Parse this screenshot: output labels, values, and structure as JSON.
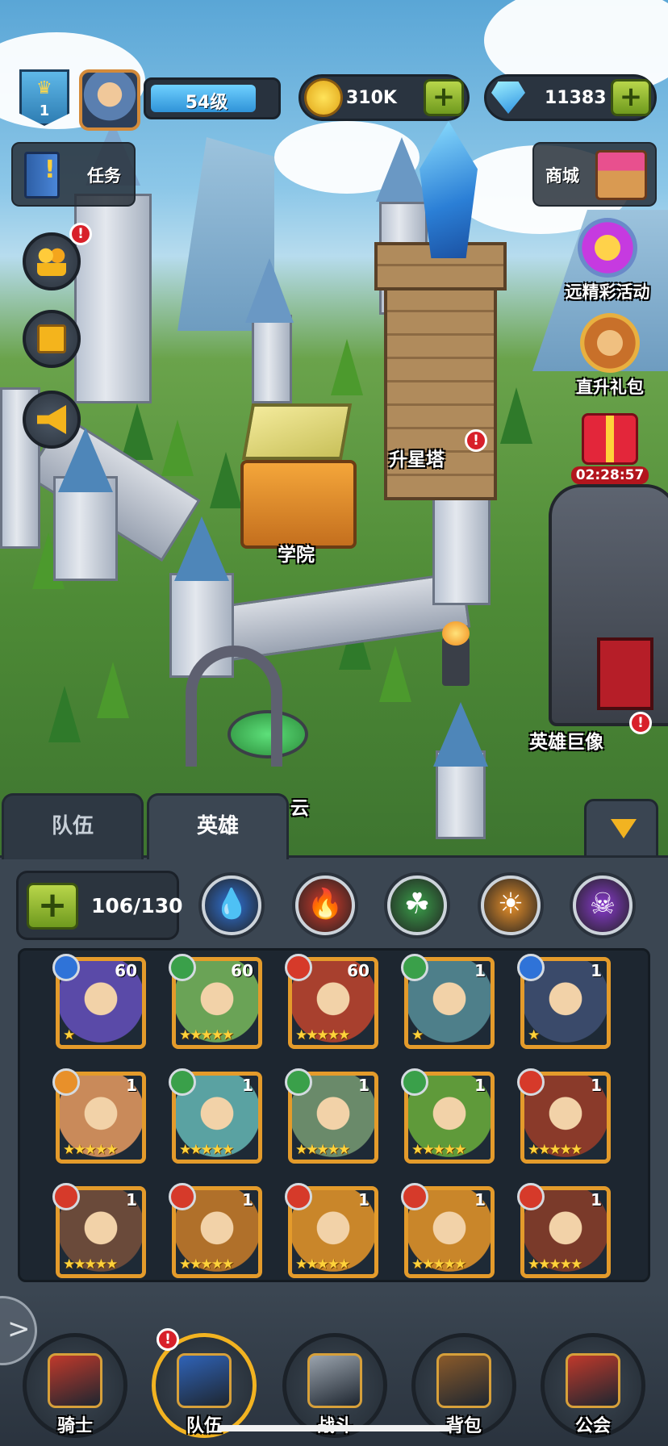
{
  "hud": {
    "rank": "1",
    "level_label": "54级",
    "gold": "310K",
    "gems": "11383"
  },
  "left_menu": {
    "quest_label": "任务"
  },
  "right_menu": {
    "shop_label": "商城",
    "events": [
      {
        "label": "远精彩活动"
      },
      {
        "label": "直升礼包"
      },
      {
        "timer": "02:28:57"
      }
    ]
  },
  "map_labels": {
    "star_tower": "升星塔",
    "academy": "学院",
    "hero_statue": "英雄巨像",
    "partial": "云"
  },
  "alert_glyph": "!",
  "panel": {
    "tabs": [
      {
        "label": "队伍",
        "active": false
      },
      {
        "label": "英雄",
        "active": true
      }
    ],
    "hero_count": "106/130",
    "element_filters": [
      {
        "name": "water",
        "icon": "water-drop-icon",
        "color": "#2f73d8",
        "glyph": "💧"
      },
      {
        "name": "fire",
        "icon": "flame-icon",
        "color": "#d63a2a",
        "glyph": "🔥"
      },
      {
        "name": "nature",
        "icon": "clover-icon",
        "color": "#3aa04a",
        "glyph": "☘"
      },
      {
        "name": "light",
        "icon": "sun-icon",
        "color": "#e8902a",
        "glyph": "☀"
      },
      {
        "name": "dark",
        "icon": "skull-icon",
        "color": "#8a3ad0",
        "glyph": "☠"
      }
    ],
    "heroes": [
      {
        "element": "water",
        "level": "60",
        "stars": "★",
        "color": "#5a4aa8"
      },
      {
        "element": "nature",
        "level": "60",
        "stars": "★★★★★",
        "color": "#6aa356"
      },
      {
        "element": "fire",
        "level": "60",
        "stars": "★★★★★",
        "color": "#a8402e"
      },
      {
        "element": "nature",
        "level": "1",
        "stars": "★",
        "color": "#4e7f8a"
      },
      {
        "element": "water",
        "level": "1",
        "stars": "★",
        "color": "#3a4a6a"
      },
      {
        "element": "light",
        "level": "1",
        "stars": "★★★★★",
        "color": "#c98a5a"
      },
      {
        "element": "nature",
        "level": "1",
        "stars": "★★★★★",
        "color": "#5aa2a2"
      },
      {
        "element": "nature",
        "level": "1",
        "stars": "★★★★★",
        "color": "#6a8a6a"
      },
      {
        "element": "nature",
        "level": "1",
        "stars": "★★★★★",
        "color": "#5f9a3a"
      },
      {
        "element": "fire",
        "level": "1",
        "stars": "★★★★★",
        "color": "#8a3a2a"
      },
      {
        "element": "fire",
        "level": "1",
        "stars": "★★★★★",
        "color": "#6a4a3a"
      },
      {
        "element": "fire",
        "level": "1",
        "stars": "★★★★★",
        "color": "#b0702a"
      },
      {
        "element": "fire",
        "level": "1",
        "stars": "★★★★★",
        "color": "#c9862a"
      },
      {
        "element": "fire",
        "level": "1",
        "stars": "★★★★★",
        "color": "#c9862a"
      },
      {
        "element": "fire",
        "level": "1",
        "stars": "★★★★★",
        "color": "#7a3a2a"
      }
    ]
  },
  "nav": [
    {
      "label": "骑士",
      "icon": "knight-helmet-icon",
      "color": "#c0392b"
    },
    {
      "label": "队伍",
      "icon": "team-shield-icon",
      "color": "#2f63b8",
      "selected": true
    },
    {
      "label": "战斗",
      "icon": "crossed-swords-icon",
      "color": "#9aa3ad"
    },
    {
      "label": "背包",
      "icon": "backpack-icon",
      "color": "#8a5a2a"
    },
    {
      "label": "公会",
      "icon": "guild-emblem-icon",
      "color": "#c0392b"
    }
  ]
}
